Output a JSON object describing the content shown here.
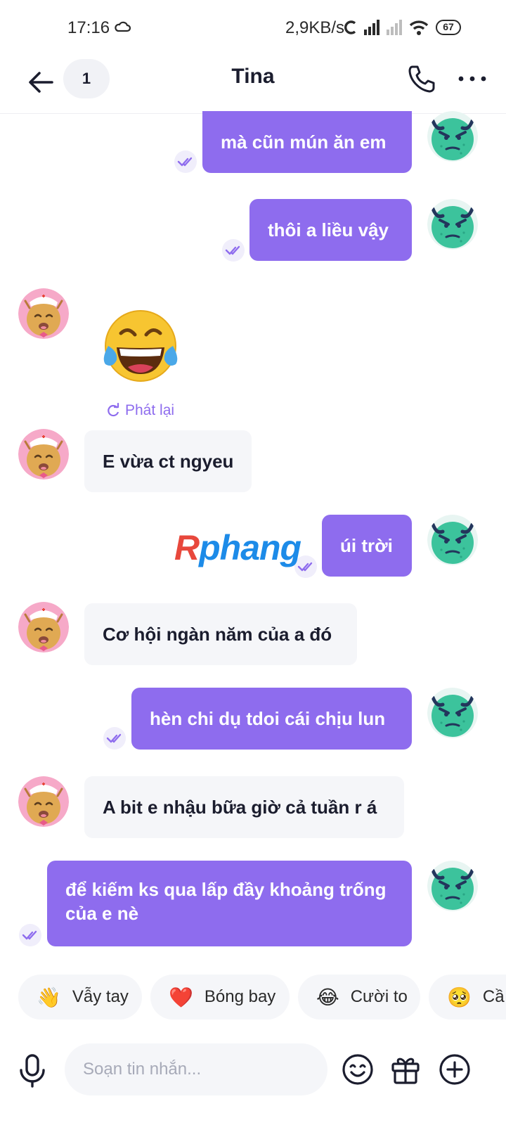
{
  "status_bar": {
    "time": "17:16",
    "net_speed": "2,9KB/s",
    "battery": "67"
  },
  "header": {
    "unread_count": "1",
    "title": "Tina"
  },
  "messages": [
    {
      "dir": "out",
      "text": "mà cũn  mún ăn em"
    },
    {
      "dir": "out",
      "text": "thôi a liều vậy"
    },
    {
      "dir": "in",
      "type": "emoji",
      "emoji": "😂",
      "replay_label": "Phát lại"
    },
    {
      "dir": "in",
      "text": "E vừa ct ngyeu"
    },
    {
      "dir": "out",
      "text": "úi trời"
    },
    {
      "dir": "in",
      "text": "Cơ hội ngàn năm của a đó"
    },
    {
      "dir": "out",
      "text": "hèn chi dụ tdoi cái chịu lun"
    },
    {
      "dir": "in",
      "text": "A bit e nhậu bữa giờ cả tuần r á"
    },
    {
      "dir": "out",
      "text": "để kiếm ks qua lấp đầy khoảng trống của e nè"
    }
  ],
  "watermark": {
    "first": "R",
    "rest": "phang"
  },
  "quick_replies": [
    {
      "emoji": "👋",
      "label": "Vẫy tay"
    },
    {
      "emoji": "❤️",
      "label": "Bóng bay"
    },
    {
      "emoji": "😂",
      "label": "Cười to"
    },
    {
      "emoji": "🥺",
      "label": "Cầ"
    }
  ],
  "composer": {
    "placeholder": "Soạn tin nhắn..."
  },
  "colors": {
    "accent": "#8e6cee",
    "incoming_bg": "#f5f6f9"
  },
  "icons": [
    "back-arrow-icon",
    "phone-icon",
    "more-icon",
    "mic-icon",
    "sticker-icon",
    "gift-icon",
    "plus-icon",
    "seen-check-icon",
    "replay-icon"
  ]
}
